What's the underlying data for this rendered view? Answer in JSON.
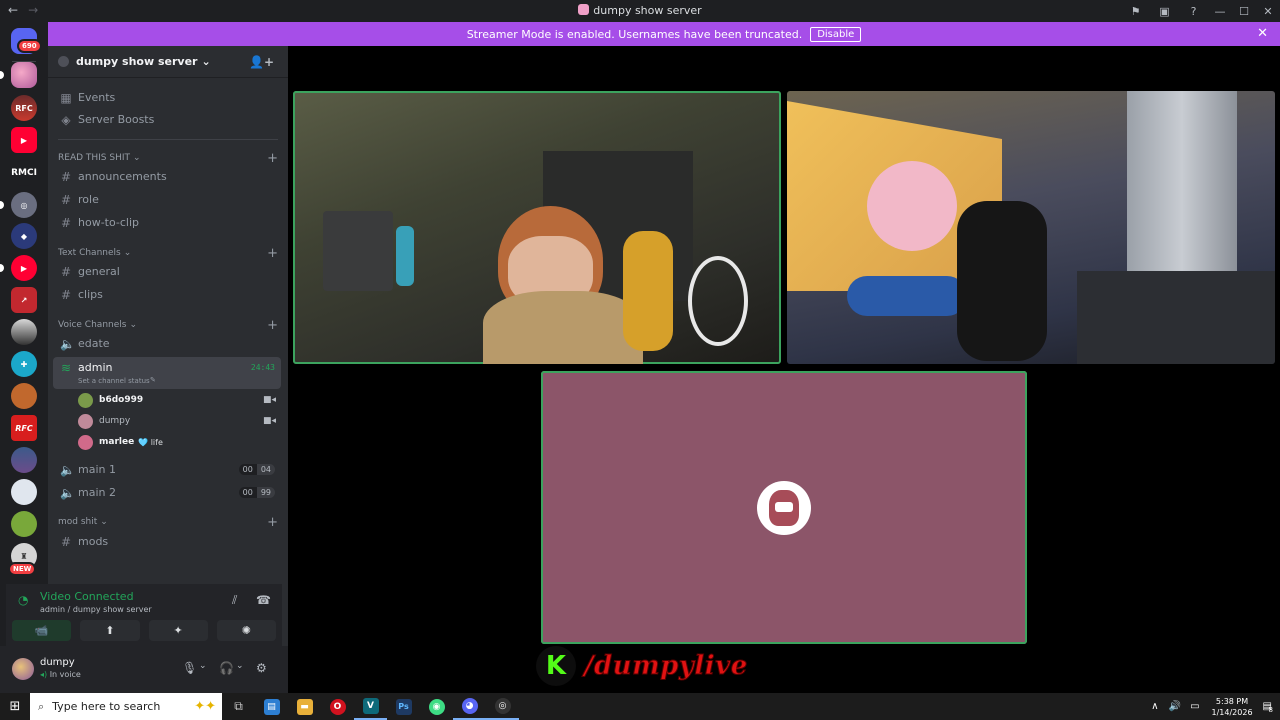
{
  "window": {
    "title": "dumpy show server",
    "back_glyph": "←",
    "forward_glyph": "→",
    "controls": [
      "⚑",
      "▣",
      "?",
      "—",
      "☐",
      "✕"
    ]
  },
  "banner": {
    "text": "Streamer Mode is enabled. Usernames have been truncated.",
    "button": "Disable",
    "close_glyph": "✕",
    "color": "#a64ee8"
  },
  "guilds": {
    "home_badge": "690",
    "rmci_label": "RMCI",
    "new_badge": "NEW"
  },
  "server": {
    "name": "dumpy show server",
    "chevron": "⌄",
    "invite_glyph": "👤+"
  },
  "sidebar": {
    "top_items": [
      {
        "icon": "calendar-icon",
        "glyph": "▦",
        "label": "Events"
      },
      {
        "icon": "boost-icon",
        "glyph": "◈",
        "label": "Server Boosts"
      }
    ],
    "categories": [
      {
        "label": "READ THIS SHIT",
        "channels": [
          "announcements",
          "role",
          "how-to-clip"
        ]
      },
      {
        "label": "Text Channels",
        "channels": [
          "general",
          "clips"
        ]
      },
      {
        "label": "Voice Channels"
      },
      {
        "label": "mod shit",
        "channels": [
          "mods"
        ]
      }
    ],
    "voice": {
      "edate": "edate",
      "admin": {
        "name": "admin",
        "timer": "24:43",
        "status_hint": "Set a channel status"
      },
      "members": [
        {
          "name": "b6do999",
          "camera": true
        },
        {
          "name": "dumpy",
          "camera": true
        },
        {
          "name": "marlee",
          "tag": "🩵 life",
          "camera": false
        }
      ],
      "main1": {
        "name": "main 1",
        "count": "00",
        "limit": "04"
      },
      "main2": {
        "name": "main 2",
        "count": "00",
        "limit": "99"
      }
    },
    "hash_glyph": "#",
    "speaker_glyph": "🔈",
    "plus_glyph": "+",
    "chev_glyph": "⌄"
  },
  "rtc": {
    "status": "Video Connected",
    "subtitle": "admin / dumpy show server",
    "buttons": [
      "📹",
      "⬆",
      "✦",
      "✺"
    ]
  },
  "user_panel": {
    "name": "dumpy",
    "status": "In voice",
    "controls": [
      "🎙",
      "⌄",
      "🎧",
      "⌄",
      "⚙"
    ]
  },
  "stage": {
    "overlay_handle": "/dumpylive",
    "overlay_k": "K"
  },
  "taskbar": {
    "start_glyph": "⊞",
    "search_placeholder": "Type here to search",
    "spark": "✦✦",
    "apps": [
      {
        "name": "task-view",
        "glyph": "⧉",
        "color": "#1c1c1c"
      },
      {
        "name": "store",
        "glyph": "▤",
        "color": "#2d7fd2"
      },
      {
        "name": "explorer",
        "glyph": "▬",
        "color": "#e8b03a"
      },
      {
        "name": "opera",
        "glyph": "O",
        "color": "#d1121f"
      },
      {
        "name": "vegas",
        "glyph": "V",
        "color": "#0e6a7a"
      },
      {
        "name": "photoshop",
        "glyph": "Ps",
        "color": "#1e3a63"
      },
      {
        "name": "android",
        "glyph": "◉",
        "color": "#3ddc84"
      },
      {
        "name": "discord",
        "glyph": "◕",
        "color": "#5865f2"
      },
      {
        "name": "obs",
        "glyph": "◎",
        "color": "#333"
      }
    ],
    "tray": {
      "arrow": "∧",
      "volume": "🔊",
      "time": "5:38 PM",
      "date": "1/14/2026",
      "notif": "8"
    }
  }
}
